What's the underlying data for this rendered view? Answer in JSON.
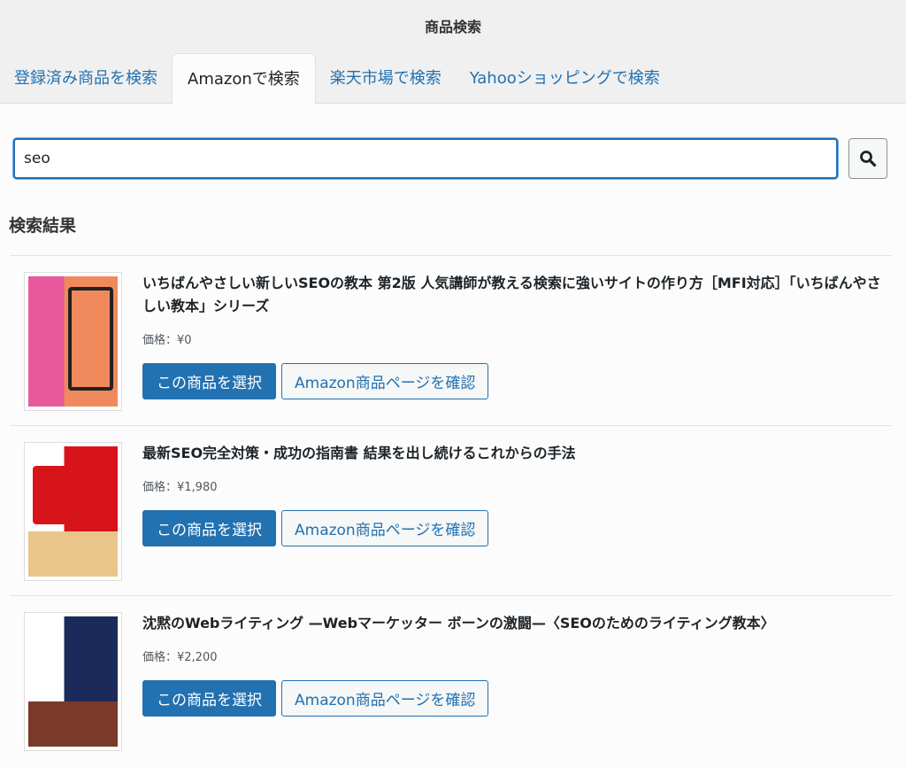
{
  "header": {
    "title": "商品検索"
  },
  "tabs": [
    {
      "label": "登録済み商品を検索"
    },
    {
      "label": "Amazonで検索",
      "active": true
    },
    {
      "label": "楽天市場で検索"
    },
    {
      "label": "Yahooショッピングで検索"
    }
  ],
  "search": {
    "value": "seo",
    "button_icon": "search-icon"
  },
  "results": {
    "heading": "検索結果",
    "select_label": "この商品を選択",
    "view_label": "Amazon商品ページを確認",
    "items": [
      {
        "title": "いちばんやさしい新しいSEOの教本 第2版 人気講師が教える検索に強いサイトの作り方［MFI対応］「いちばんやさしい教本」シリーズ",
        "price": "価格：¥0",
        "cover_colors": [
          "#e8589c",
          "#f08a5d",
          "#222222"
        ]
      },
      {
        "title": "最新SEO完全対策・成功の指南書 結果を出し続けるこれからの手法",
        "price": "価格：¥1,980",
        "cover_colors": [
          "#ffffff",
          "#d7141a",
          "#e9c58a"
        ]
      },
      {
        "title": "沈黙のWebライティング —Webマーケッター ボーンの激闘—〈SEOのためのライティング教本〉",
        "price": "価格：¥2,200",
        "cover_colors": [
          "#ffffff",
          "#1a2a5a",
          "#7a3a2a"
        ]
      }
    ]
  },
  "colors": {
    "accent": "#2271b1",
    "header_bg": "#f0f0f0"
  }
}
